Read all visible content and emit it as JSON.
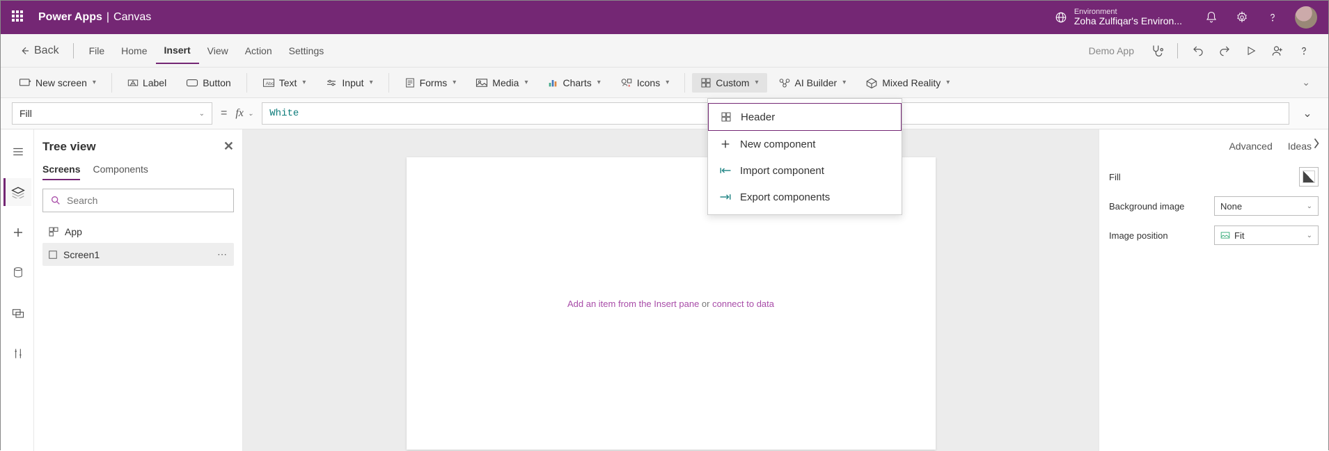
{
  "topbar": {
    "brand": "Power Apps",
    "subbrand": "Canvas",
    "env_label": "Environment",
    "env_name": "Zoha Zulfiqar's Environ..."
  },
  "menubar": {
    "back": "Back",
    "items": [
      "File",
      "Home",
      "Insert",
      "View",
      "Action",
      "Settings"
    ],
    "active_index": 2,
    "appname": "Demo App"
  },
  "ribbon": {
    "new_screen": "New screen",
    "label": "Label",
    "button": "Button",
    "text": "Text",
    "input": "Input",
    "forms": "Forms",
    "media": "Media",
    "charts": "Charts",
    "icons": "Icons",
    "custom": "Custom",
    "ai_builder": "AI Builder",
    "mixed_reality": "Mixed Reality"
  },
  "custom_popup": {
    "items": [
      {
        "label": "Header",
        "icon": "component"
      },
      {
        "label": "New component",
        "icon": "plus"
      },
      {
        "label": "Import component",
        "icon": "import"
      },
      {
        "label": "Export components",
        "icon": "export"
      }
    ],
    "selected_index": 0
  },
  "formula": {
    "property": "Fill",
    "value": "White"
  },
  "tree": {
    "title": "Tree view",
    "tabs": [
      "Screens",
      "Components"
    ],
    "active_tab": 0,
    "search_placeholder": "Search",
    "items": [
      {
        "label": "App",
        "icon": "app",
        "selected": false
      },
      {
        "label": "Screen1",
        "icon": "screen",
        "selected": true
      }
    ]
  },
  "canvas": {
    "hint_prefix": "Add an item from the Insert pane",
    "hint_or": " or ",
    "hint_link2": "connect to data"
  },
  "props": {
    "tabs": [
      "Advanced",
      "Ideas"
    ],
    "fill_label": "Fill",
    "bg_label": "Background image",
    "bg_value": "None",
    "imgpos_label": "Image position",
    "imgpos_value": "Fit"
  }
}
